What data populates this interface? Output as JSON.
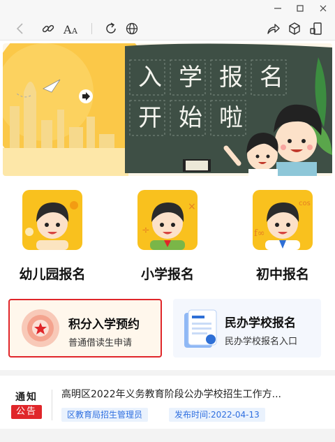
{
  "window": {
    "controls": {
      "minimize_icon": "minimize-icon",
      "maximize_icon": "maximize-icon",
      "close_icon": "close-icon"
    }
  },
  "toolbar": {
    "icons": [
      "back-icon",
      "link-icon",
      "font-size-icon",
      "refresh-icon",
      "globe-icon",
      "share-icon",
      "package-icon",
      "dock-icon"
    ],
    "font_icon_text": "AA"
  },
  "banner": {
    "title_line1": [
      "入",
      "学",
      "报",
      "名"
    ],
    "title_line2": [
      "开",
      "始",
      "啦"
    ],
    "colors": {
      "board": "#3e4f45",
      "sky": "#fbc848",
      "grass": "#3c8d40"
    }
  },
  "categories": [
    {
      "label": "幼儿园报名",
      "icon": "kindergarten-avatar-icon",
      "color": "#f9c11e"
    },
    {
      "label": "小学报名",
      "icon": "primary-school-avatar-icon",
      "color": "#f9c11e"
    },
    {
      "label": "初中报名",
      "icon": "middle-school-avatar-icon",
      "color": "#f9c11e"
    }
  ],
  "cards": {
    "points": {
      "title": "积分入学预约",
      "subtitle": "普通借读生申请",
      "icon": "star-medal-icon"
    },
    "private": {
      "title": "民办学校报名",
      "subtitle": "民办学校报名入口",
      "icon": "document-list-icon"
    }
  },
  "notice": {
    "badge_top": "通知",
    "badge_bottom": "公告",
    "title": "高明区2022年义务教育阶段公办学校招生工作方...",
    "department": "区教育局招生管理员",
    "date": "发布时间:2022-04-13",
    "accent": "#e0262a",
    "tag_color": "#2f6fe0"
  }
}
